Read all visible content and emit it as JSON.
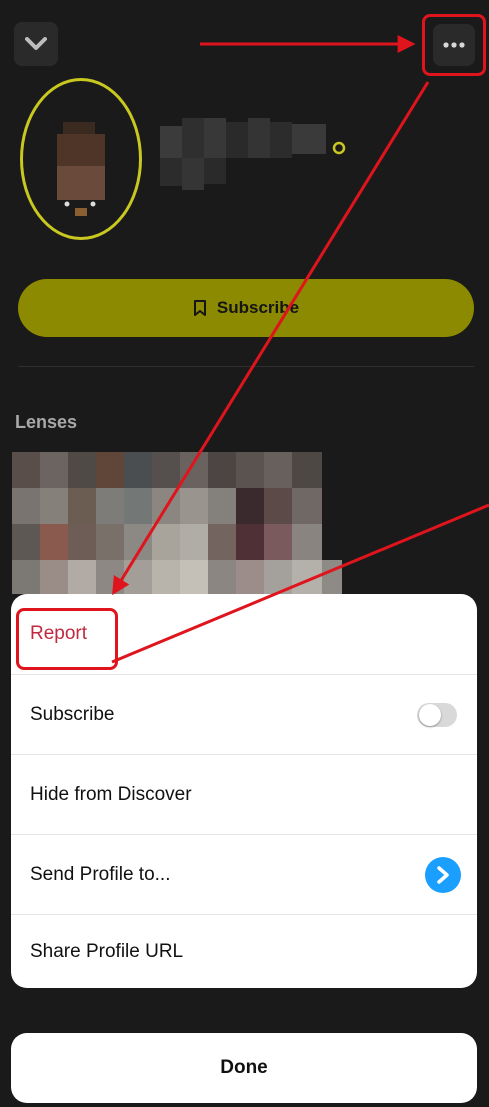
{
  "header": {
    "collapse_icon": "chevron-down-icon",
    "more_icon": "more-horizontal-icon"
  },
  "profile": {
    "subscribe_label": "Subscribe",
    "accent_color": "#8c8a00"
  },
  "lenses": {
    "title": "Lenses"
  },
  "menu": {
    "items": [
      {
        "label": "Report",
        "color": "#c0293f"
      },
      {
        "label": "Subscribe",
        "toggle_on": false
      },
      {
        "label": "Hide from Discover"
      },
      {
        "label": "Send Profile to..."
      },
      {
        "label": "Share Profile URL"
      }
    ],
    "done_label": "Done"
  },
  "annotation": {
    "color": "#e0141c"
  }
}
